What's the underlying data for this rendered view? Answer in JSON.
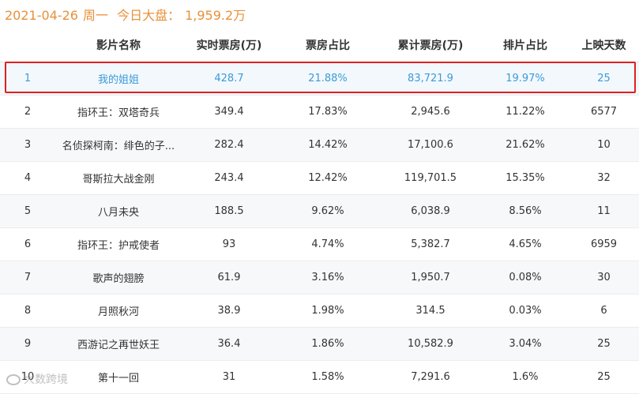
{
  "header": {
    "date": "2021-04-26",
    "weekday": "周一",
    "total_label": "今日大盘：",
    "total_value": "1,959.2万"
  },
  "columns": [
    "",
    "影片名称",
    "实时票房(万)",
    "票房占比",
    "累计票房(万)",
    "排片占比",
    "上映天数"
  ],
  "rows": [
    [
      "1",
      "我的姐姐",
      "428.7",
      "21.88%",
      "83,721.9",
      "19.97%",
      "25"
    ],
    [
      "2",
      "指环王：双塔奇兵",
      "349.4",
      "17.83%",
      "2,945.6",
      "11.22%",
      "6577"
    ],
    [
      "3",
      "名侦探柯南：绯色的子...",
      "282.4",
      "14.42%",
      "17,100.6",
      "21.62%",
      "10"
    ],
    [
      "4",
      "哥斯拉大战金刚",
      "243.4",
      "12.42%",
      "119,701.5",
      "15.35%",
      "32"
    ],
    [
      "5",
      "八月未央",
      "188.5",
      "9.62%",
      "6,038.9",
      "8.56%",
      "11"
    ],
    [
      "6",
      "指环王：护戒使者",
      "93",
      "4.74%",
      "5,382.7",
      "4.65%",
      "6959"
    ],
    [
      "7",
      "歌声的翅膀",
      "61.9",
      "3.16%",
      "1,950.7",
      "0.08%",
      "30"
    ],
    [
      "8",
      "月照秋河",
      "38.9",
      "1.98%",
      "314.5",
      "0.03%",
      "6"
    ],
    [
      "9",
      "西游记之再世妖王",
      "36.4",
      "1.86%",
      "10,582.9",
      "3.04%",
      "25"
    ],
    [
      "10",
      "第十一回",
      "31",
      "1.58%",
      "7,291.6",
      "1.6%",
      "25"
    ]
  ],
  "watermark": "大数跨境",
  "colors": {
    "header_text": "#e8913a",
    "highlight_border": "#e02020",
    "highlight_text": "#3a9bd8"
  }
}
